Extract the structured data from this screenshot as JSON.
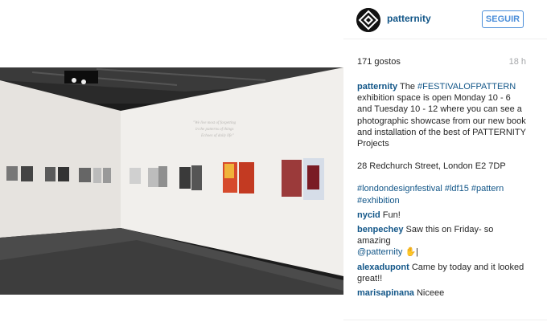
{
  "post": {
    "username": "patternity",
    "follow_label": "SEGUIR",
    "likes": "171 gostos",
    "time_ago": "18 h",
    "caption": {
      "username": "patternity",
      "text_before": " The ",
      "hashtag": "#FESTIVALOFPATTERN",
      "text_after": " exhibition space is open Monday 10 - 6 and Tuesday 10 - 12 where you can see a photographic showcase from our new book and installation of the best of PATTERNITY Projects",
      "address": "28 Redchurch Street, London E2 7DP",
      "tags_line1": "#londondesignfestival #ldf15 #pattern",
      "tags_line2": "#exhibition"
    },
    "comments": [
      {
        "user": "nycid",
        "text": "Fun!"
      },
      {
        "user": "benpechey",
        "text": "Saw this on Friday- so amazing",
        "mention": "@patternity",
        "tail": " ✋|"
      },
      {
        "user": "alexadupont",
        "text": "Came by today and it looked great!!"
      },
      {
        "user": "marisapinana",
        "text": "Niceee"
      }
    ]
  },
  "wall_quote": "\"We live most of forgetting… in the patterns of things… Echoes of daily life\"",
  "icons": {
    "avatar": "patternity-logo-icon"
  }
}
